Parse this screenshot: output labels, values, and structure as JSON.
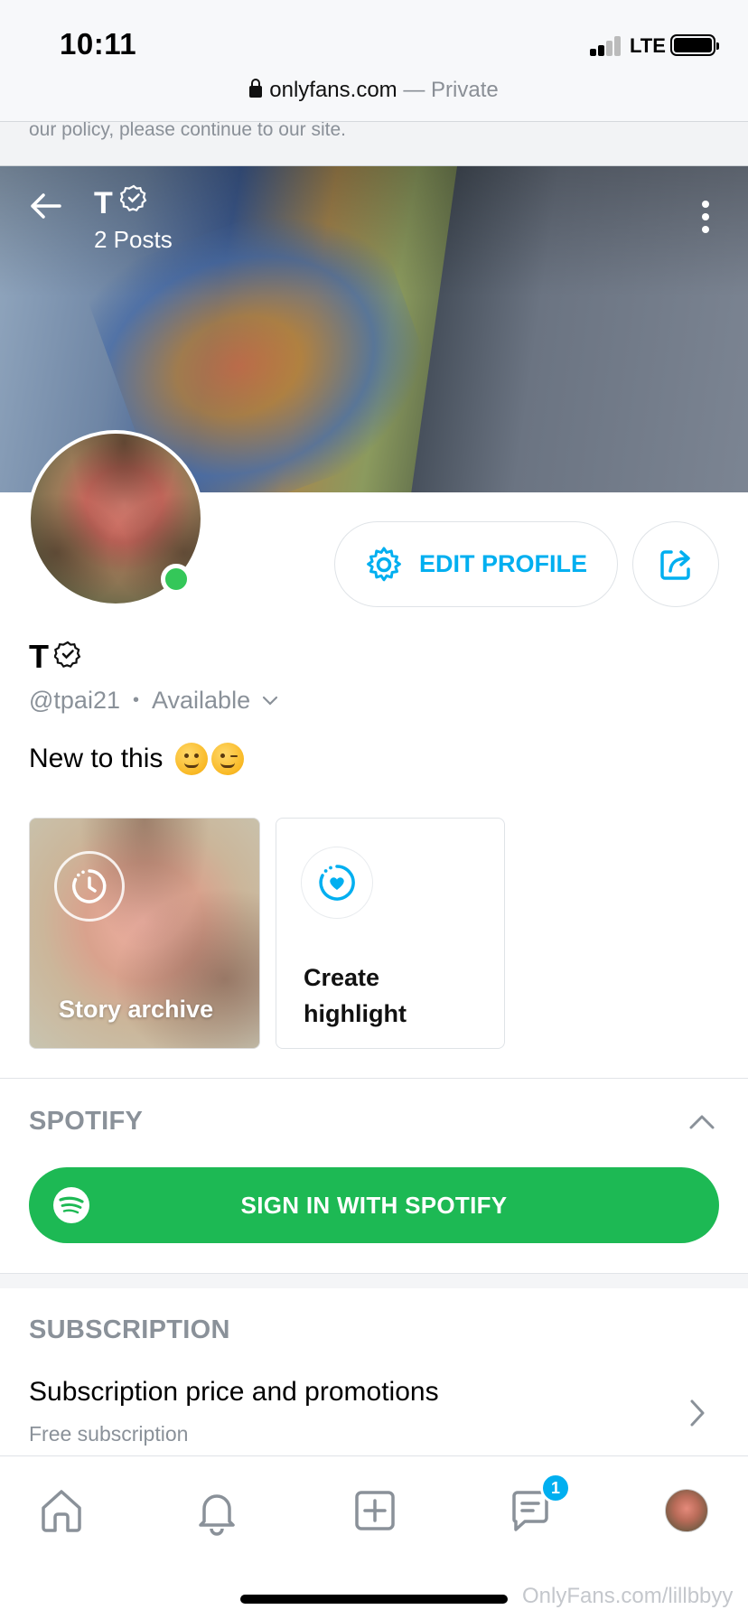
{
  "status_bar": {
    "time": "10:11",
    "network": "LTE"
  },
  "browser": {
    "domain": "onlyfans.com",
    "separator": " — ",
    "mode": "Private"
  },
  "notice": {
    "text": "our policy, please continue to our site."
  },
  "cover": {
    "title": "T",
    "posts": "2 Posts"
  },
  "profile": {
    "name": "T",
    "handle": "@tpai21",
    "status": "Available",
    "bio": "New to this",
    "edit_label": "EDIT PROFILE",
    "online": true
  },
  "highlights": {
    "story_label": "Story archive",
    "create_label": "Create highlight"
  },
  "spotify": {
    "section_title": "SPOTIFY",
    "button_label": "SIGN IN WITH SPOTIFY"
  },
  "subscription": {
    "section_title": "SUBSCRIPTION",
    "row_title": "Subscription price and promotions",
    "row_subtitle": "Free subscription"
  },
  "tabbar": {
    "items": [
      "home-icon",
      "bell-icon",
      "plus-square-icon",
      "messages-icon",
      "profile-avatar"
    ],
    "message_badge": "1"
  },
  "watermark": "OnlyFans.com/lillbbyy",
  "colors": {
    "accent": "#00aff0",
    "spotify": "#1db954",
    "online": "#34c759",
    "muted": "#8a9199"
  }
}
